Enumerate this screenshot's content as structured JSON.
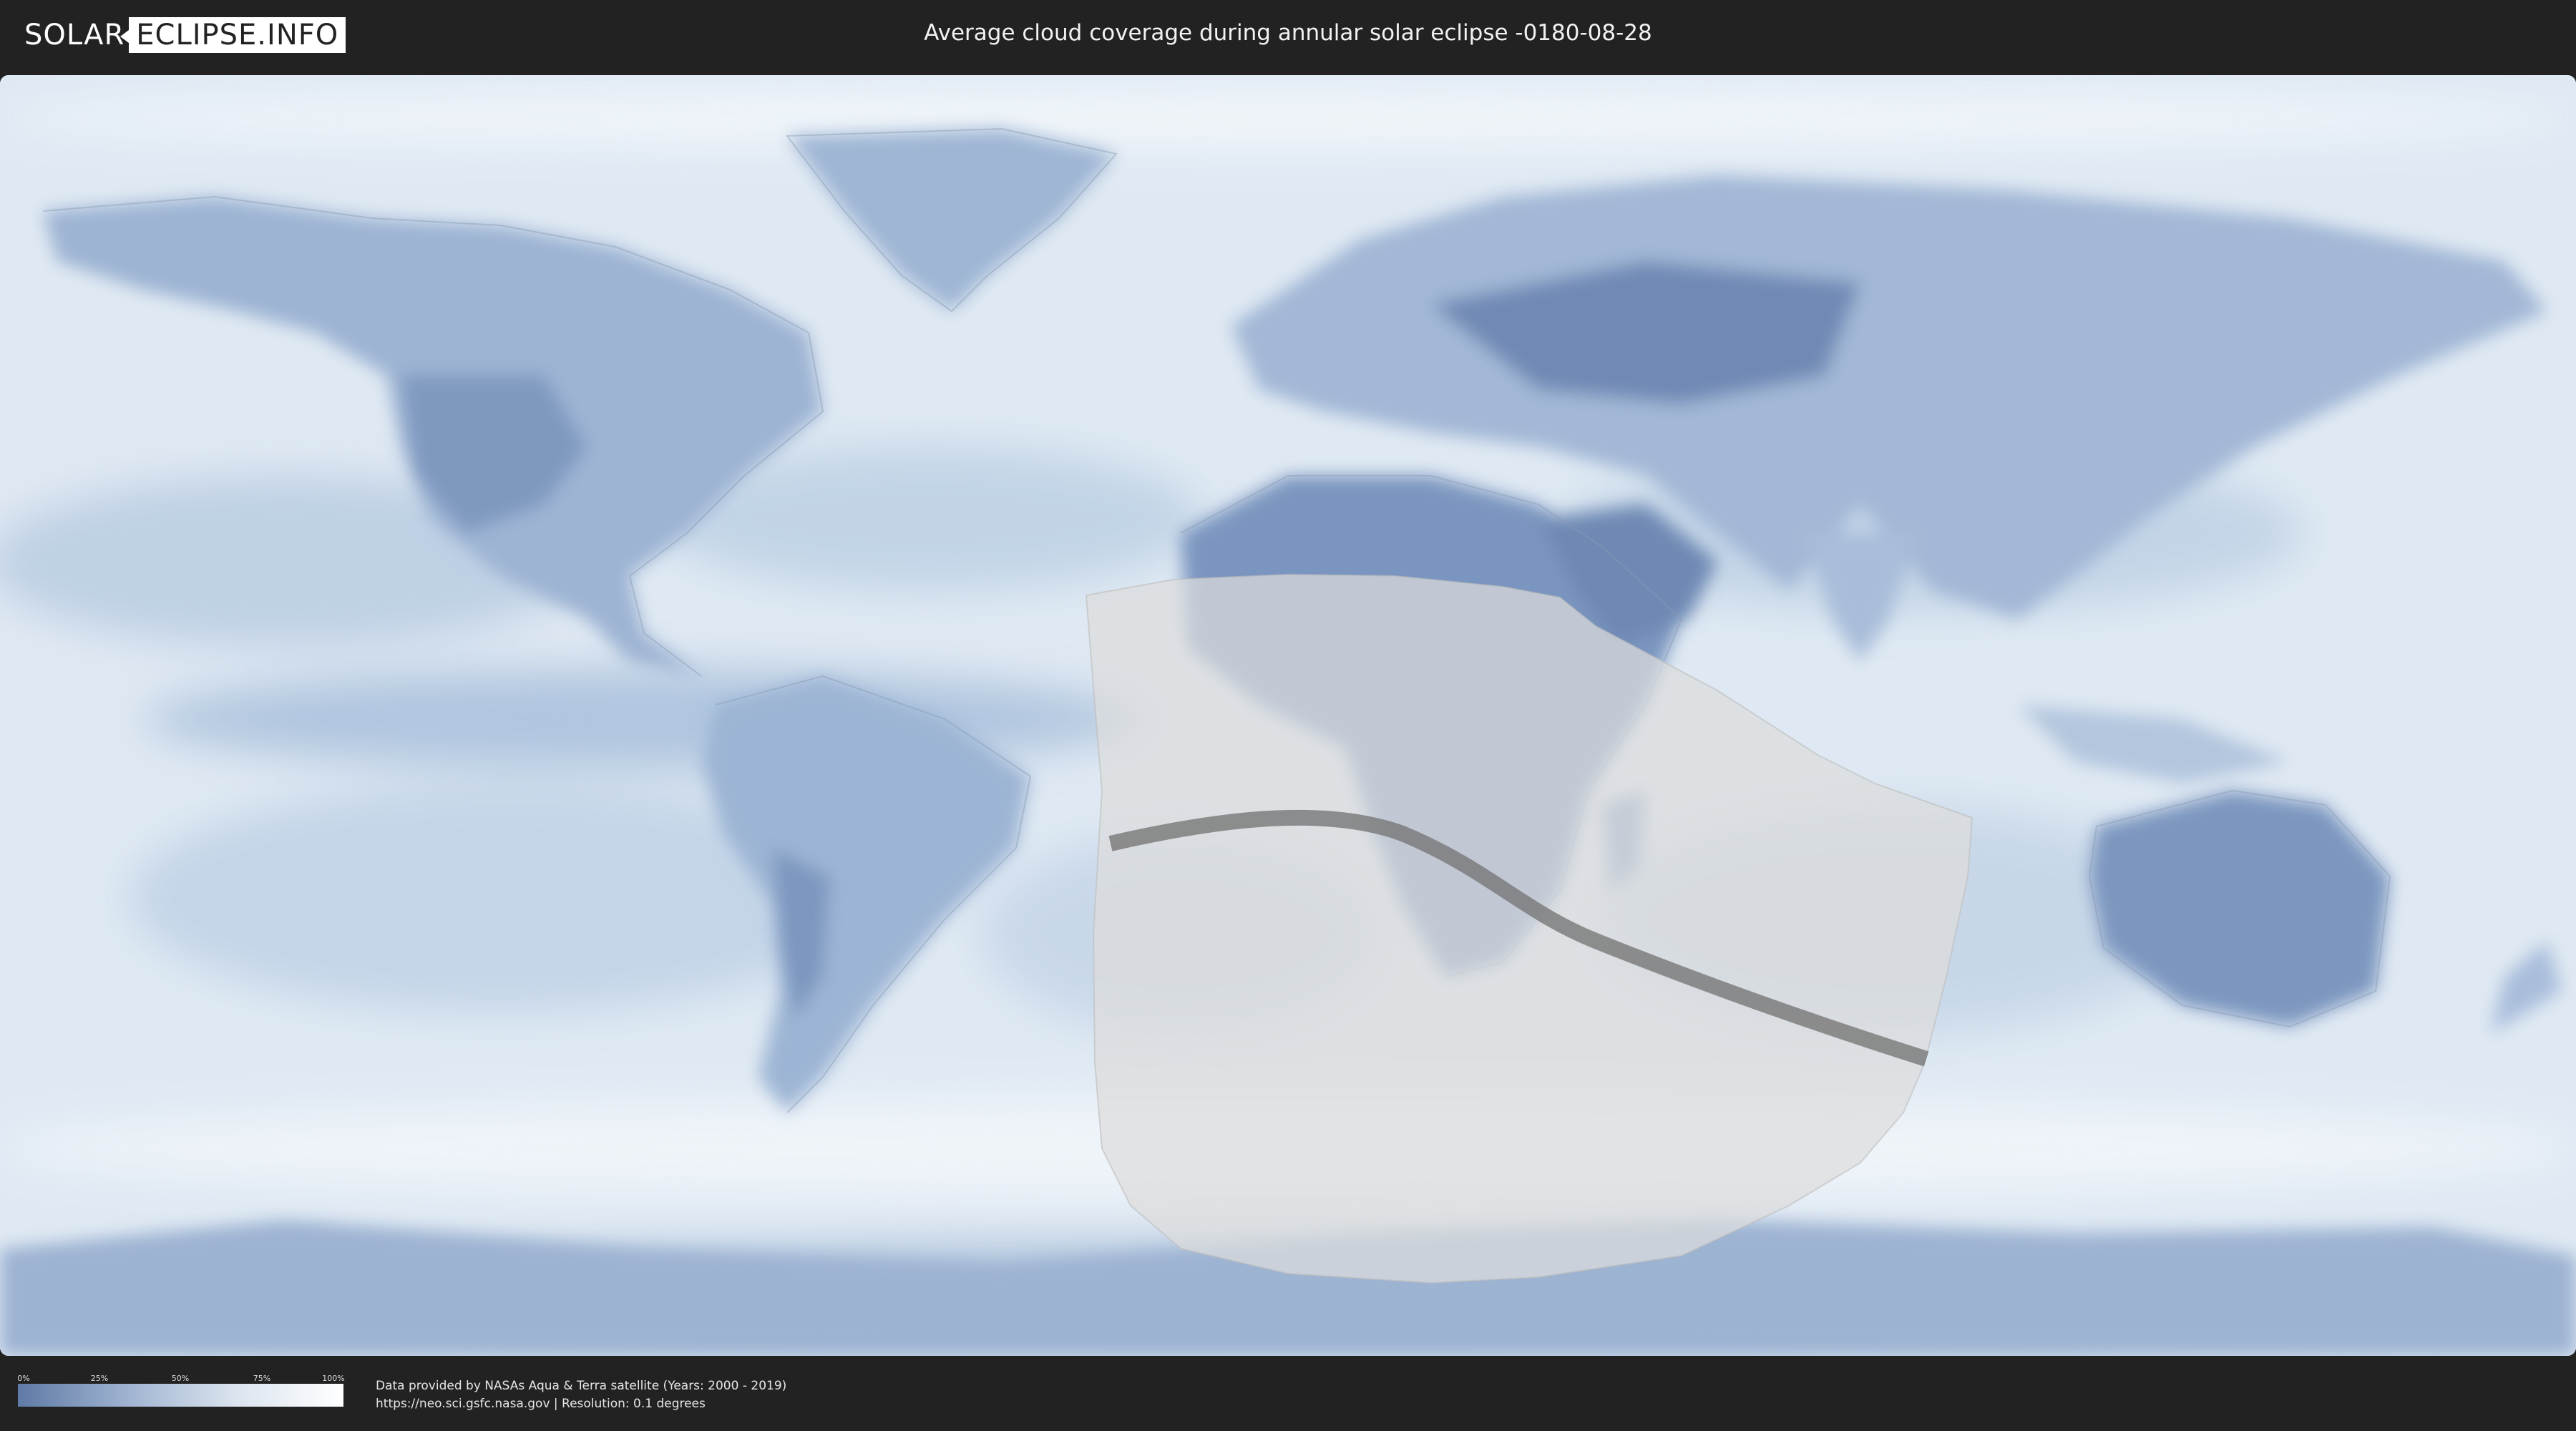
{
  "header": {
    "logo_part1": "SOLAR",
    "logo_part2": "ECLIPSE.INFO",
    "title": "Average cloud coverage during annular solar eclipse -0180-08-28"
  },
  "legend": {
    "ticks": [
      "0%",
      "25%",
      "50%",
      "75%",
      "100%"
    ],
    "gradient_colors": [
      "#5f7aa6",
      "#9fb3d0",
      "#dbe4ef",
      "#ffffff"
    ]
  },
  "footer": {
    "credit_line1": "Data provided by NASAs Aqua & Terra satellite (Years: 2000 - 2019)",
    "credit_line2": "https://neo.sci.gsfc.nasa.gov | Resolution: 0.1 degrees"
  },
  "colors": {
    "background": "#222222",
    "ocean_clouds": "#dfe9f3",
    "clear_land": "#6d88b3",
    "eclipse_zone": "#d9d9d9",
    "central_path": "#777777"
  }
}
